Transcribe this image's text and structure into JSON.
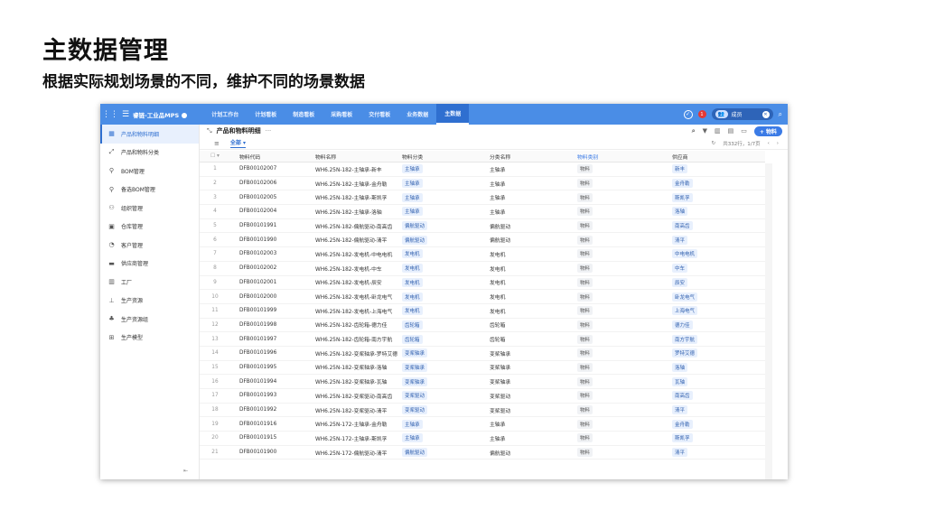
{
  "slide": {
    "title": "主数据管理",
    "subtitle": "根据实际规划场景的不同，维护不同的场景数据"
  },
  "topbar": {
    "app_name": "睿链-工业品MPS",
    "tabs": [
      "计划工作台",
      "计划看板",
      "制造看板",
      "采购看板",
      "交付看板",
      "业务数据",
      "主数据"
    ],
    "active_tab": "主数据",
    "badge": "1",
    "user_label": "成员"
  },
  "sidebar": {
    "items": [
      {
        "label": "产品和物料明细",
        "icon": "grid-icon",
        "active": true
      },
      {
        "label": "产品和物料分类",
        "icon": "expand-icon"
      },
      {
        "label": "BOM管理",
        "icon": "tree-icon"
      },
      {
        "label": "备选BOM管理",
        "icon": "tree-icon"
      },
      {
        "label": "组织管理",
        "icon": "org-icon"
      },
      {
        "label": "仓库管理",
        "icon": "warehouse-icon"
      },
      {
        "label": "客户管理",
        "icon": "customer-icon"
      },
      {
        "label": "供应商管理",
        "icon": "truck-icon"
      },
      {
        "label": "工厂",
        "icon": "factory-icon"
      },
      {
        "label": "生产资源",
        "icon": "resource-icon"
      },
      {
        "label": "生产资源组",
        "icon": "resource-group-icon"
      },
      {
        "label": "生产模型",
        "icon": "model-icon"
      }
    ]
  },
  "main": {
    "title": "产品和物料明细",
    "more": "···",
    "add_button": "+ 物料",
    "view_tab": "全部",
    "pagination": "共332行，1/7页"
  },
  "table": {
    "headers": [
      "物料代码",
      "物料名称",
      "物料分类",
      "分类名称",
      "物料类别",
      "供应商"
    ],
    "rows": [
      {
        "idx": "1",
        "code": "DFB00102007",
        "name": "WH6.25N-182-主轴承-新丰",
        "cat": "主轴承",
        "catname": "主轴承",
        "type": "物料",
        "sup": "新丰"
      },
      {
        "idx": "2",
        "code": "DFB00102006",
        "name": "WH6.25N-182-主轴承-金舟勒",
        "cat": "主轴承",
        "catname": "主轴承",
        "type": "物料",
        "sup": "金舟勒"
      },
      {
        "idx": "3",
        "code": "DFB00102005",
        "name": "WH6.25N-182-主轴承-斯凯孚",
        "cat": "主轴承",
        "catname": "主轴承",
        "type": "物料",
        "sup": "斯凯孚"
      },
      {
        "idx": "4",
        "code": "DFB00102004",
        "name": "WH6.25N-182-主轴承-洛轴",
        "cat": "主轴承",
        "catname": "主轴承",
        "type": "物料",
        "sup": "洛轴"
      },
      {
        "idx": "5",
        "code": "DFB00101991",
        "name": "WH6.25N-182-偏航驱动-南高齿",
        "cat": "偏航驱动",
        "catname": "偏航驱动",
        "type": "物料",
        "sup": "南高齿"
      },
      {
        "idx": "6",
        "code": "DFB00101990",
        "name": "WH6.25N-182-偏航驱动-清平",
        "cat": "偏航驱动",
        "catname": "偏航驱动",
        "type": "物料",
        "sup": "清平"
      },
      {
        "idx": "7",
        "code": "DFB00102003",
        "name": "WH6.25N-182-发电机-中电电机",
        "cat": "发电机",
        "catname": "发电机",
        "type": "物料",
        "sup": "中电电机"
      },
      {
        "idx": "8",
        "code": "DFB00102002",
        "name": "WH6.25N-182-发电机-中车",
        "cat": "发电机",
        "catname": "发电机",
        "type": "物料",
        "sup": "中车"
      },
      {
        "idx": "9",
        "code": "DFB00102001",
        "name": "WH6.25N-182-发电机-辰安",
        "cat": "发电机",
        "catname": "发电机",
        "type": "物料",
        "sup": "辰安"
      },
      {
        "idx": "10",
        "code": "DFB00102000",
        "name": "WH6.25N-182-发电机-卧龙电气",
        "cat": "发电机",
        "catname": "发电机",
        "type": "物料",
        "sup": "卧龙电气"
      },
      {
        "idx": "11",
        "code": "DFB00101999",
        "name": "WH6.25N-182-发电机-上海电气",
        "cat": "发电机",
        "catname": "发电机",
        "type": "物料",
        "sup": "上海电气"
      },
      {
        "idx": "12",
        "code": "DFB00101998",
        "name": "WH6.25N-182-齿轮箱-德力佳",
        "cat": "齿轮箱",
        "catname": "齿轮箱",
        "type": "物料",
        "sup": "德力佳"
      },
      {
        "idx": "13",
        "code": "DFB00101997",
        "name": "WH6.25N-182-齿轮箱-南方宇航",
        "cat": "齿轮箱",
        "catname": "齿轮箱",
        "type": "物料",
        "sup": "南方宇航"
      },
      {
        "idx": "14",
        "code": "DFB00101996",
        "name": "WH6.25N-182-变桨轴承-罗特艾德",
        "cat": "变桨轴承",
        "catname": "变桨轴承",
        "type": "物料",
        "sup": "罗特艾德"
      },
      {
        "idx": "15",
        "code": "DFB00101995",
        "name": "WH6.25N-182-变桨轴承-洛轴",
        "cat": "变桨轴承",
        "catname": "变桨轴承",
        "type": "物料",
        "sup": "洛轴"
      },
      {
        "idx": "16",
        "code": "DFB00101994",
        "name": "WH6.25N-182-变桨轴承-瓦轴",
        "cat": "变桨轴承",
        "catname": "变桨轴承",
        "type": "物料",
        "sup": "瓦轴"
      },
      {
        "idx": "17",
        "code": "DFB00101993",
        "name": "WH6.25N-182-变桨驱动-南高齿",
        "cat": "变桨驱动",
        "catname": "变桨驱动",
        "type": "物料",
        "sup": "南高齿"
      },
      {
        "idx": "18",
        "code": "DFB00101992",
        "name": "WH6.25N-182-变桨驱动-清平",
        "cat": "变桨驱动",
        "catname": "变桨驱动",
        "type": "物料",
        "sup": "清平"
      },
      {
        "idx": "19",
        "code": "DFB00101916",
        "name": "WH6.25N-172-主轴承-金舟勒",
        "cat": "主轴承",
        "catname": "主轴承",
        "type": "物料",
        "sup": "金舟勒"
      },
      {
        "idx": "20",
        "code": "DFB00101915",
        "name": "WH6.25N-172-主轴承-斯凯孚",
        "cat": "主轴承",
        "catname": "主轴承",
        "type": "物料",
        "sup": "斯凯孚"
      },
      {
        "idx": "21",
        "code": "DFB00101900",
        "name": "WH6.25N-172-偏航驱动-清平",
        "cat": "偏航驱动",
        "catname": "偏航驱动",
        "type": "物料",
        "sup": "清平"
      }
    ]
  }
}
